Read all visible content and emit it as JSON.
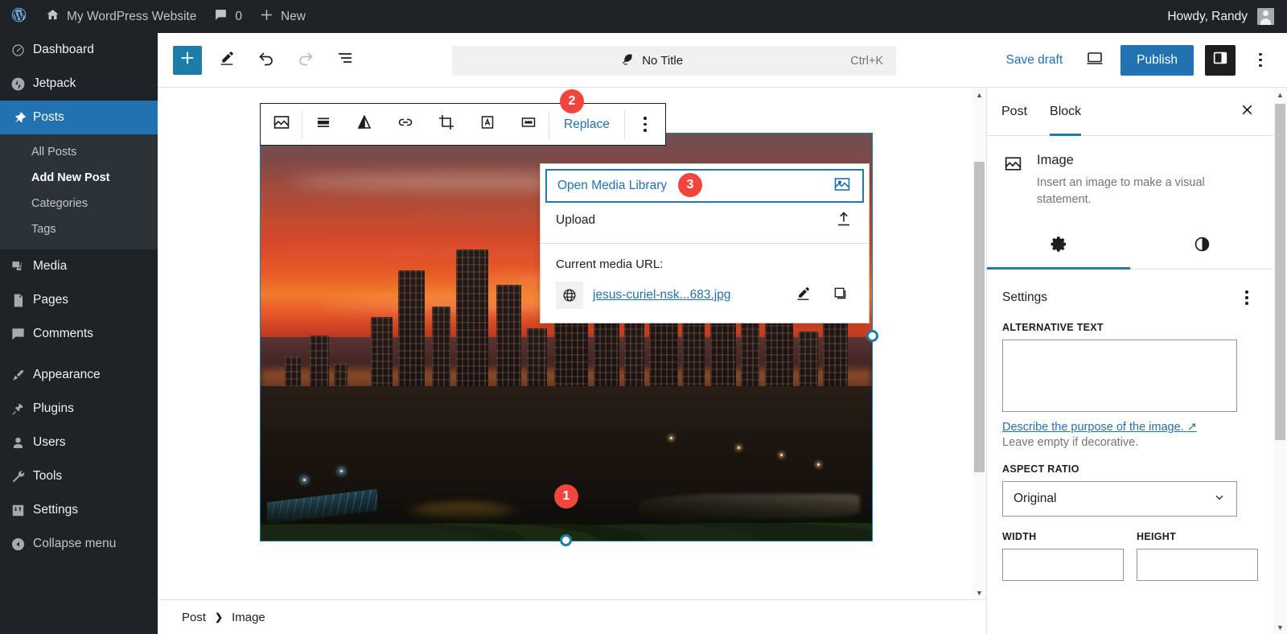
{
  "adminbar": {
    "logo_icon": "wordpress-icon",
    "home_icon": "home-icon",
    "site_name": "My WordPress Website",
    "comments_icon": "comment-bubble-icon",
    "comments_count": "0",
    "new_icon": "plus-icon",
    "new_label": "New",
    "howdy": "Howdy, Randy",
    "avatar_icon": "user-avatar-icon"
  },
  "sidebar": {
    "items": [
      {
        "label": "Dashboard",
        "icon": "dashboard-gauge-icon"
      },
      {
        "label": "Jetpack",
        "icon": "jetpack-icon"
      },
      {
        "label": "Posts",
        "icon": "pin-icon",
        "current": true
      },
      {
        "label": "Media",
        "icon": "media-icon"
      },
      {
        "label": "Pages",
        "icon": "pages-icon"
      },
      {
        "label": "Comments",
        "icon": "comment-bubble-icon"
      },
      {
        "label": "Appearance",
        "icon": "paintbrush-icon"
      },
      {
        "label": "Plugins",
        "icon": "plug-icon"
      },
      {
        "label": "Users",
        "icon": "user-icon"
      },
      {
        "label": "Tools",
        "icon": "wrench-icon"
      },
      {
        "label": "Settings",
        "icon": "sliders-icon"
      }
    ],
    "submenu": [
      {
        "label": "All Posts",
        "current": false
      },
      {
        "label": "Add New Post",
        "current": true
      },
      {
        "label": "Categories",
        "current": false
      },
      {
        "label": "Tags",
        "current": false
      }
    ],
    "collapse": {
      "label": "Collapse menu",
      "icon": "collapse-arrow-icon"
    }
  },
  "header": {
    "add_block_icon": "plus-icon",
    "edit_tool_icon": "pencil-icon",
    "undo_icon": "undo-arrow-icon",
    "redo_icon": "redo-arrow-icon",
    "list_view_icon": "list-view-icon",
    "doc_bar": {
      "doc_icon": "feather-icon",
      "title": "No Title",
      "shortcut": "Ctrl+K"
    },
    "save_draft": "Save draft",
    "preview_icon": "desktop-preview-icon",
    "publish": "Publish",
    "sidebar_toggle_icon": "settings-panel-icon",
    "options_icon": "kebab-menu-icon"
  },
  "block_toolbar": {
    "buttons": [
      {
        "icon": "image-block-icon",
        "name": "block-type-image"
      },
      {
        "icon": "align-icon",
        "name": "align-button"
      },
      {
        "icon": "transform-triangle-icon",
        "name": "filter-button"
      },
      {
        "icon": "link-icon",
        "name": "link-button"
      },
      {
        "icon": "crop-icon",
        "name": "crop-button"
      },
      {
        "icon": "text-over-image-icon",
        "name": "add-text-button"
      },
      {
        "icon": "more-dots-box-icon",
        "name": "more-styles-button"
      }
    ],
    "replace_label": "Replace",
    "options_icon": "kebab-menu-icon"
  },
  "replace_popup": {
    "open_media_library": "Open Media Library",
    "open_media_library_icon": "image-picker-icon",
    "upload": "Upload",
    "upload_icon": "upload-arrow-icon",
    "current_media_label": "Current media URL:",
    "globe_icon": "globe-icon",
    "media_url": "jesus-curiel-nsk...683.jpg",
    "edit_icon": "pencil-icon",
    "copy_icon": "copy-icon"
  },
  "badges": [
    {
      "number": "1",
      "target": "image-block"
    },
    {
      "number": "2",
      "target": "replace-button"
    },
    {
      "number": "3",
      "target": "open-media-library"
    }
  ],
  "inspector": {
    "tabs": [
      {
        "label": "Post",
        "active": false
      },
      {
        "label": "Block",
        "active": true
      }
    ],
    "close_icon": "close-x-icon",
    "block": {
      "icon": "image-block-icon",
      "title": "Image",
      "description": "Insert an image to make a visual statement."
    },
    "icon_tabs": [
      {
        "icon": "gear-icon",
        "name": "settings-tab",
        "active": true
      },
      {
        "icon": "contrast-circle-icon",
        "name": "styles-tab",
        "active": false
      }
    ],
    "settings_title": "Settings",
    "settings_options_icon": "kebab-menu-icon",
    "alt_text": {
      "label": "ALTERNATIVE TEXT",
      "value": "",
      "placeholder": "",
      "helper_link": "Describe the purpose of the image.",
      "helper_link_icon": "external-link-arrow-icon",
      "helper_note": "Leave empty if decorative."
    },
    "aspect_ratio": {
      "label": "ASPECT RATIO",
      "value": "Original",
      "caret_icon": "chevron-down-icon"
    },
    "width": {
      "label": "WIDTH",
      "value": ""
    },
    "height": {
      "label": "HEIGHT",
      "value": ""
    }
  },
  "footer": {
    "breadcrumb": [
      "Post",
      "Image"
    ],
    "separator_icon": "chevron-right-icon"
  },
  "colors": {
    "admin_dark": "#1d2327",
    "admin_submenu": "#2c3338",
    "accent_blue": "#2271b1",
    "badge_red": "#f4443e",
    "handle_blue": "#1e7ca8"
  }
}
